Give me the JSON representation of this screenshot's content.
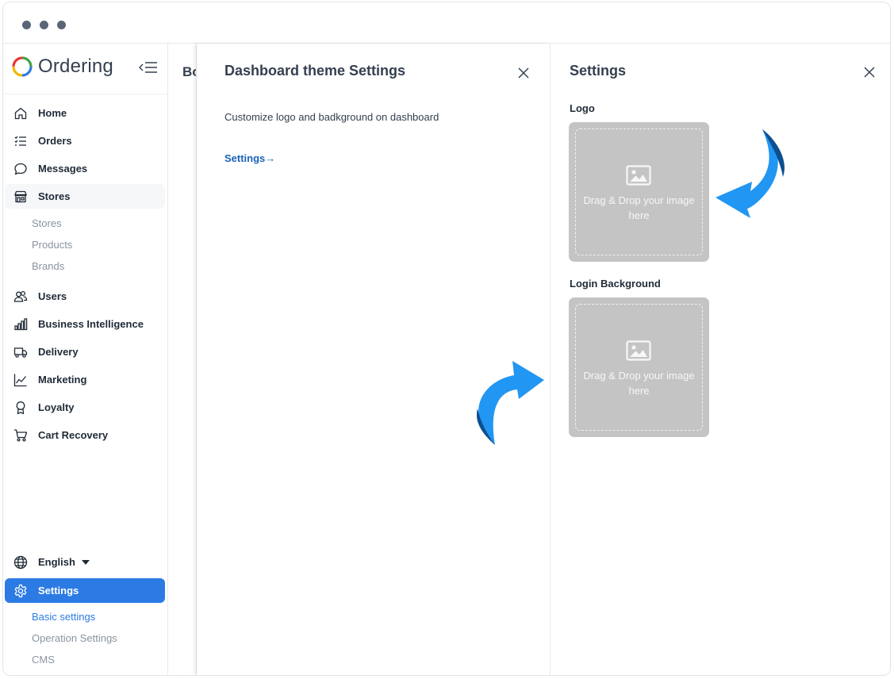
{
  "app": {
    "brand": "Ordering"
  },
  "sidebar": {
    "items": [
      {
        "id": "home",
        "label": "Home",
        "icon": "home-icon"
      },
      {
        "id": "orders",
        "label": "Orders",
        "icon": "list-icon"
      },
      {
        "id": "messages",
        "label": "Messages",
        "icon": "chat-bubble-icon"
      },
      {
        "id": "stores",
        "label": "Stores",
        "icon": "store-icon"
      },
      {
        "id": "users",
        "label": "Users",
        "icon": "users-icon"
      },
      {
        "id": "bi",
        "label": "Business Intelligence",
        "icon": "bar-chart-icon"
      },
      {
        "id": "delivery",
        "label": "Delivery",
        "icon": "truck-icon"
      },
      {
        "id": "marketing",
        "label": "Marketing",
        "icon": "line-chart-icon"
      },
      {
        "id": "loyalty",
        "label": "Loyalty",
        "icon": "award-icon"
      },
      {
        "id": "cart",
        "label": "Cart Recovery",
        "icon": "cart-icon"
      }
    ],
    "stores_sub": [
      "Stores",
      "Products",
      "Brands"
    ],
    "language": {
      "label": "English",
      "icon": "globe-icon"
    },
    "settings": {
      "label": "Settings",
      "icon": "gear-icon"
    },
    "settings_sub": [
      "Basic settings",
      "Operation Settings",
      "CMS"
    ]
  },
  "background_page": {
    "title_fragment": "Bo"
  },
  "theme_panel": {
    "title": "Dashboard theme Settings",
    "description": "Customize logo and badkground on dashboard",
    "link": "Settings",
    "link_arrow": "→"
  },
  "settings_panel": {
    "title": "Settings",
    "logo_label": "Logo",
    "login_bg_label": "Login Background",
    "dropzone_text": "Drag & Drop your image here"
  },
  "colors": {
    "accent": "#2c7be5",
    "link": "#1b63b7",
    "dropzone": "#c4c4c4",
    "annotation_arrow": "#2196f3",
    "annotation_arrow_dark": "#0d4f8f"
  }
}
